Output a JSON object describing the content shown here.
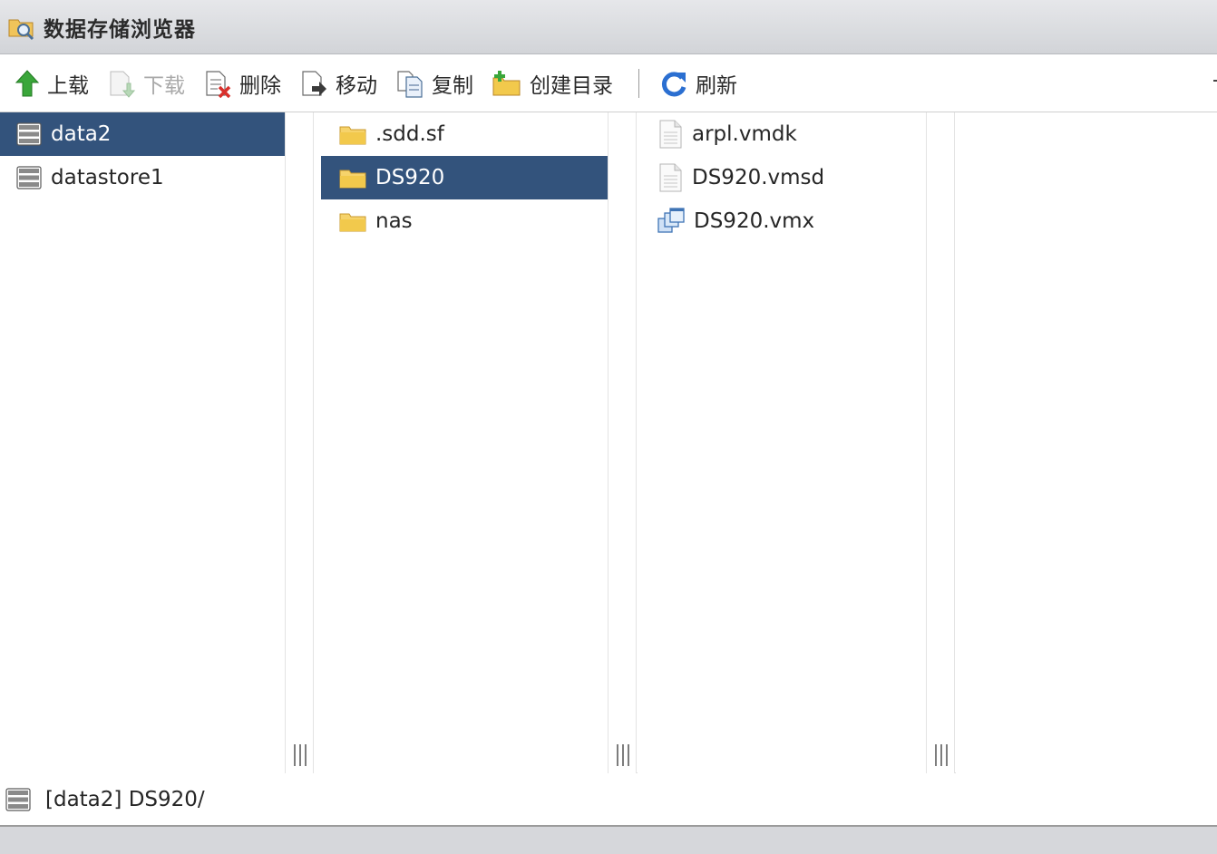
{
  "window": {
    "title": "数据存储浏览器"
  },
  "toolbar": {
    "upload": "上载",
    "download": "下载",
    "delete": "删除",
    "move": "移动",
    "copy": "复制",
    "mkdir": "创建目录",
    "refresh": "刷新"
  },
  "datastores": [
    {
      "name": "data2",
      "selected": true
    },
    {
      "name": "datastore1",
      "selected": false
    }
  ],
  "folders": [
    {
      "name": ".sdd.sf",
      "selected": false
    },
    {
      "name": "DS920",
      "selected": true
    },
    {
      "name": "nas",
      "selected": false
    }
  ],
  "files": [
    {
      "name": "arpl.vmdk",
      "icon": "document-icon"
    },
    {
      "name": "DS920.vmsd",
      "icon": "document-icon"
    },
    {
      "name": "DS920.vmx",
      "icon": "vm-config-icon"
    }
  ],
  "status": {
    "path": "[data2] DS920/"
  },
  "colors": {
    "selection": "#33537c",
    "folder": "#f2c94c",
    "upload_arrow": "#3aa63a",
    "refresh": "#2b6fd1",
    "delete_x": "#d9302c"
  }
}
